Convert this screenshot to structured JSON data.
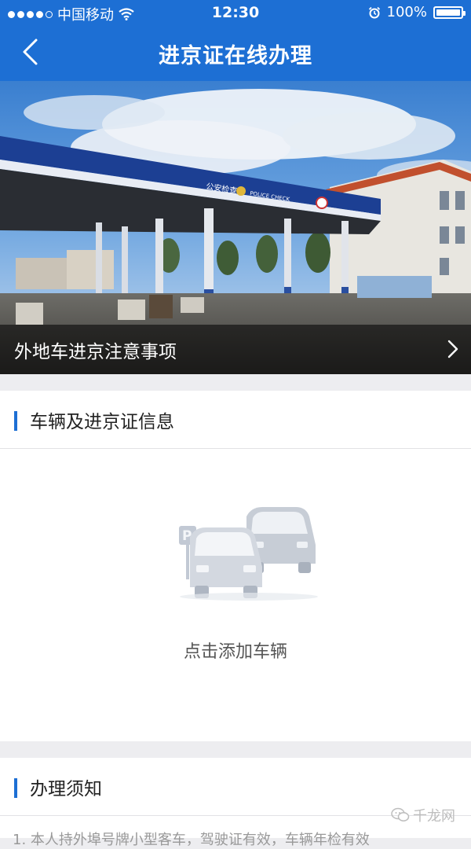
{
  "status_bar": {
    "carrier": "中国移动",
    "time": "12:30",
    "battery": "100%"
  },
  "nav": {
    "title": "进京证在线办理",
    "back_icon": "chevron-left-icon"
  },
  "banner": {
    "caption": "外地车进京注意事项",
    "sign_left": "公安检查",
    "sign_right": "POLICE CHECK"
  },
  "vehicle_section": {
    "title": "车辆及进京证信息",
    "empty_label": "点击添加车辆"
  },
  "notice_section": {
    "title": "办理须知",
    "body_text": "1. 本人持外埠号牌小型客车，驾驶证有效，车辆年检有效"
  },
  "watermark": "千龙网",
  "colors": {
    "accent": "#1d6fd4",
    "background": "#ededf0"
  }
}
